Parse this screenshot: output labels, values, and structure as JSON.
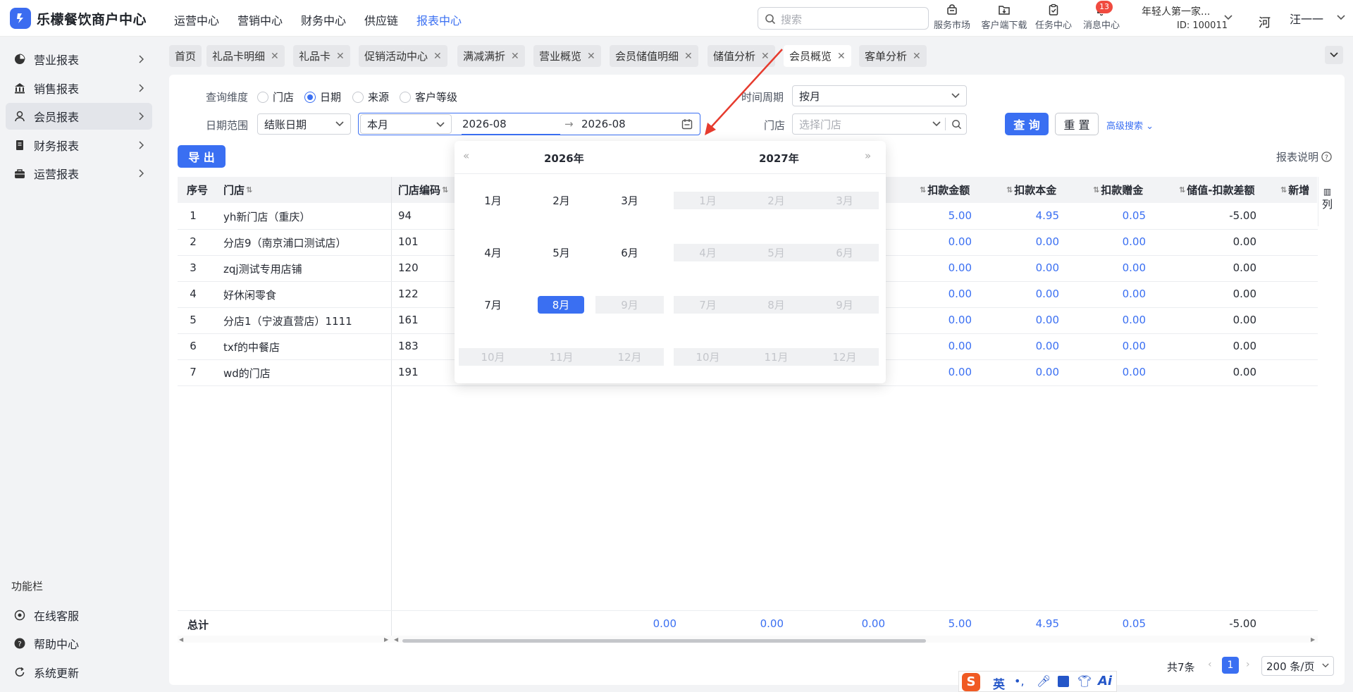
{
  "app": {
    "title": "乐檬餐饮商户中心"
  },
  "nav": [
    "运营中心",
    "营销中心",
    "财务中心",
    "供应链",
    "报表中心"
  ],
  "nav_active": "报表中心",
  "search": {
    "placeholder": "搜索"
  },
  "header_icons": [
    {
      "label": "服务市场",
      "icon": "store-icon"
    },
    {
      "label": "客户端下载",
      "icon": "download-folder-icon"
    },
    {
      "label": "任务中心",
      "icon": "clipboard-icon"
    },
    {
      "label": "消息中心",
      "icon": "bell-icon"
    }
  ],
  "message_badge": "13",
  "store": {
    "name": "年轻人第一家...",
    "id": "ID: 100011"
  },
  "user": {
    "avatar": "河",
    "name": "汪一一"
  },
  "sidebar": {
    "items": [
      {
        "label": "营业报表",
        "icon": "pie-chart-icon"
      },
      {
        "label": "销售报表",
        "icon": "bank-icon"
      },
      {
        "label": "会员报表",
        "icon": "user-icon"
      },
      {
        "label": "财务报表",
        "icon": "ledger-icon"
      },
      {
        "label": "运营报表",
        "icon": "briefcase-icon"
      }
    ],
    "func_title": "功能栏",
    "func_items": [
      {
        "label": "在线客服",
        "icon": "headset-icon"
      },
      {
        "label": "帮助中心",
        "icon": "help-icon"
      },
      {
        "label": "系统更新",
        "icon": "refresh-icon"
      }
    ]
  },
  "tabs": [
    "首页",
    "礼品卡明细",
    "礼品卡",
    "促销活动中心",
    "满减满折",
    "营业概览",
    "会员储值明细",
    "储值分析",
    "会员概览",
    "客单分析"
  ],
  "tab_active": "会员概览",
  "filters": {
    "dimension_label": "查询维度",
    "dimension_options": [
      "门店",
      "日期",
      "来源",
      "客户等级"
    ],
    "dimension_selected": "日期",
    "period_label": "时间周期",
    "period_value": "按月",
    "date_range_label": "日期范围",
    "date_type": "结账日期",
    "preset": "本月",
    "start": "2026-08",
    "end": "2026-08",
    "store_label": "门店",
    "store_placeholder": "选择门店",
    "query_btn": "查 询",
    "reset_btn": "重 置",
    "advanced": "高级搜索"
  },
  "export_btn": "导 出",
  "report_note": "报表说明",
  "columns_toggle": "列",
  "table": {
    "headers": [
      "序号",
      "门店",
      "门店编码",
      "扣款金额",
      "扣款本金",
      "扣款赠金",
      "储值-扣款差额",
      "新增"
    ],
    "rows": [
      {
        "idx": "1",
        "store": "yh新门店（重庆）",
        "code": "94",
        "amt": "5.00",
        "principal": "4.95",
        "bonus": "0.05",
        "diff": "-5.00"
      },
      {
        "idx": "2",
        "store": "分店9（南京浦口测试店）",
        "code": "101",
        "amt": "0.00",
        "principal": "0.00",
        "bonus": "0.00",
        "diff": "0.00"
      },
      {
        "idx": "3",
        "store": "zqj测试专用店铺",
        "code": "120",
        "amt": "0.00",
        "principal": "0.00",
        "bonus": "0.00",
        "diff": "0.00"
      },
      {
        "idx": "4",
        "store": "好休闲零食",
        "code": "122",
        "amt": "0.00",
        "principal": "0.00",
        "bonus": "0.00",
        "diff": "0.00"
      },
      {
        "idx": "5",
        "store": "分店1（宁波直营店）1111",
        "code": "161",
        "amt": "0.00",
        "principal": "0.00",
        "bonus": "0.00",
        "diff": "0.00"
      },
      {
        "idx": "6",
        "store": "txf的中餐店",
        "code": "183",
        "amt": "0.00",
        "principal": "0.00",
        "bonus": "0.00",
        "diff": "0.00"
      },
      {
        "idx": "7",
        "store": "wd的门店",
        "code": "191",
        "amt": "0.00",
        "principal": "0.00",
        "bonus": "0.00",
        "diff": "0.00"
      }
    ],
    "total_label": "总计",
    "totals": [
      "0.00",
      "0.00",
      "0.00",
      "5.00",
      "4.95",
      "0.05",
      "-5.00"
    ]
  },
  "calendar": {
    "left_year": "2026年",
    "right_year": "2027年",
    "months": [
      "1月",
      "2月",
      "3月",
      "4月",
      "5月",
      "6月",
      "7月",
      "8月",
      "9月",
      "10月",
      "11月",
      "12月"
    ],
    "selected": "8月"
  },
  "pagination": {
    "total": "共7条",
    "page": "1",
    "page_size": "200 条/页"
  },
  "ime": {
    "lang": "英"
  }
}
